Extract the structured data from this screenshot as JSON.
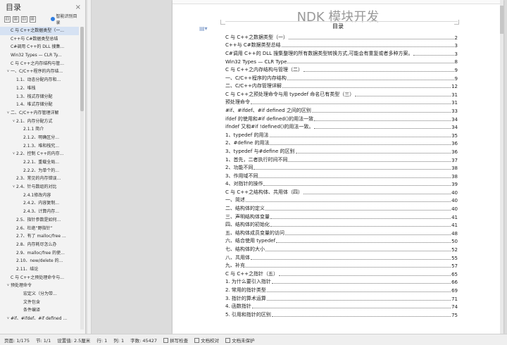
{
  "sidebar": {
    "title": "目录",
    "close_icon": "×",
    "tools": [
      "⊟",
      "⊞",
      "⊟",
      "⊞"
    ],
    "smart_label": "智能识别目录",
    "items": [
      {
        "text": "C 与 C++之数据类型（一...",
        "level": 0,
        "caret": "",
        "active": true
      },
      {
        "text": "C++与 C#数据类型总结",
        "level": 0,
        "caret": ""
      },
      {
        "text": "C#调用 C++的 DLL 搜集...",
        "level": 0,
        "caret": ""
      },
      {
        "text": "Win32 Types — CLR Ty...",
        "level": 0,
        "caret": ""
      },
      {
        "text": "C 与 C++之内存结构与管...",
        "level": 0,
        "caret": ""
      },
      {
        "text": "一、C/C++程序的内存结...",
        "level": 0,
        "caret": "∨"
      },
      {
        "text": "1.1、动态分配内存和...",
        "level": 1,
        "caret": ""
      },
      {
        "text": "1.2、堆栈",
        "level": 1,
        "caret": ""
      },
      {
        "text": "1.3、栈式存储分配",
        "level": 1,
        "caret": ""
      },
      {
        "text": "1.4、堆式存储分配",
        "level": 1,
        "caret": ""
      },
      {
        "text": "二、C/C++内存管理详解",
        "level": 0,
        "caret": "∨"
      },
      {
        "text": "2.1、内存分配方式",
        "level": 1,
        "caret": "∨"
      },
      {
        "text": "2.1.1 简介",
        "level": 2,
        "caret": ""
      },
      {
        "text": "2.1.2、明确区分...",
        "level": 2,
        "caret": ""
      },
      {
        "text": "2.1.3、堆和栈究...",
        "level": 2,
        "caret": ""
      },
      {
        "text": "2.2、控制 C++的内存...",
        "level": 1,
        "caret": "∨"
      },
      {
        "text": "2.2.1、重载全局...",
        "level": 2,
        "caret": ""
      },
      {
        "text": "2.2.2、为单个的...",
        "level": 2,
        "caret": ""
      },
      {
        "text": "2.3、常见的内存错误...",
        "level": 1,
        "caret": ""
      },
      {
        "text": "2.4、针与数组的对比",
        "level": 1,
        "caret": "∨"
      },
      {
        "text": "2.4.1修改内容",
        "level": 2,
        "caret": ""
      },
      {
        "text": "2.4.2、内容复制...",
        "level": 2,
        "caret": ""
      },
      {
        "text": "2.4.3、计算内存...",
        "level": 2,
        "caret": ""
      },
      {
        "text": "2.5、指针参数是如何...",
        "level": 1,
        "caret": ""
      },
      {
        "text": "2.6、杜绝“野指针”",
        "level": 1,
        "caret": ""
      },
      {
        "text": "2.7、有了 malloc/free ...",
        "level": 1,
        "caret": ""
      },
      {
        "text": "2.8、内存耗尽怎么办",
        "level": 1,
        "caret": ""
      },
      {
        "text": "2.9、malloc/free 的使...",
        "level": 1,
        "caret": ""
      },
      {
        "text": "2.10、new/delete 的...",
        "level": 1,
        "caret": ""
      },
      {
        "text": "2.11、结论",
        "level": 1,
        "caret": ""
      },
      {
        "text": "C 与 C++之预处理命令与...",
        "level": 0,
        "caret": ""
      },
      {
        "text": "预处理命令",
        "level": 0,
        "caret": "∨"
      },
      {
        "text": "宏定义（分为带...",
        "level": 2,
        "caret": ""
      },
      {
        "text": "文件包含",
        "level": 2,
        "caret": ""
      },
      {
        "text": "条件编译",
        "level": 2,
        "caret": ""
      },
      {
        "text": "#if、#ifdef、#if defined ...",
        "level": 0,
        "caret": "∨"
      }
    ]
  },
  "document": {
    "header": "NDK 模块开发",
    "subtitle": "目录",
    "entries": [
      {
        "t": "C 与 C++之数据类型（一）",
        "p": "2"
      },
      {
        "t": "C++与 C#数据类型总结",
        "p": "3"
      },
      {
        "t": "C#调用 C++的 DLL 搜集整理的所有数据类型转换方式,可能会有重复或者多种方案。",
        "p": "3"
      },
      {
        "t": "Win32 Types — CLR Type",
        "p": "8"
      },
      {
        "t": "C 与 C++之内存结构与管理（二）",
        "p": "9"
      },
      {
        "t": "一、C/C++程序的内存结构",
        "p": "9"
      },
      {
        "t": "二、C/C++内存管理详解",
        "p": "12"
      },
      {
        "t": "C 与 C++之预处理命令与用 typedef 命名已有类型（三）",
        "p": "31"
      },
      {
        "t": "预处理命令",
        "p": "31"
      },
      {
        "t": "#if、#ifdef、#if defined 之间的区别",
        "p": "33"
      },
      {
        "t": "ifdef 的使用和#if defined()的用法一致",
        "p": "34"
      },
      {
        "t": "ifndef 又和#if !defined()的用法一致。",
        "p": "34"
      },
      {
        "t": "1、typedef 的用法",
        "p": "35"
      },
      {
        "t": "2、#define 的用法",
        "p": "36"
      },
      {
        "t": "3、typedef 与#define 的区别",
        "p": "36"
      },
      {
        "t": "1、首先，二者执行时间不同",
        "p": "37"
      },
      {
        "t": "2、功能不同",
        "p": "38"
      },
      {
        "t": "3、作用域不同",
        "p": "38"
      },
      {
        "t": "4、对指针的操作",
        "p": "39"
      },
      {
        "t": "C 与 C++之结构体、共用体（四）",
        "p": "40"
      },
      {
        "t": "一、简述",
        "p": "40"
      },
      {
        "t": "二、结构体的定义",
        "p": "40"
      },
      {
        "t": "三、声明结构体变量",
        "p": "41"
      },
      {
        "t": "四、结构体的初始化",
        "p": "41"
      },
      {
        "t": "五、结构体成员变量的访问",
        "p": "48"
      },
      {
        "t": "六、结合使用 typedef",
        "p": "50"
      },
      {
        "t": "七、结构体的大小",
        "p": "52"
      },
      {
        "t": "八、共用体",
        "p": "55"
      },
      {
        "t": "九、补充",
        "p": "57"
      },
      {
        "t": "C 与 C++之指针（五）",
        "p": "65"
      },
      {
        "t": "1. 为什么要引入指针",
        "p": "66"
      },
      {
        "t": "2. 常用的指针类型",
        "p": "69"
      },
      {
        "t": "3. 指针的算术运算",
        "p": "71"
      },
      {
        "t": "4. 函数指针",
        "p": "74"
      },
      {
        "t": "5. 引用和指针的区别",
        "p": "75"
      }
    ]
  },
  "statusbar": {
    "page": "页面: 1/175",
    "section": "节: 1/1",
    "setting": "设置值: 2.5厘米",
    "row": "行: 1",
    "col": "列: 1",
    "words": "字数: 45427",
    "spell_check": "拼写检查",
    "doc_check": "文档校对",
    "protect": "文档未保护"
  }
}
